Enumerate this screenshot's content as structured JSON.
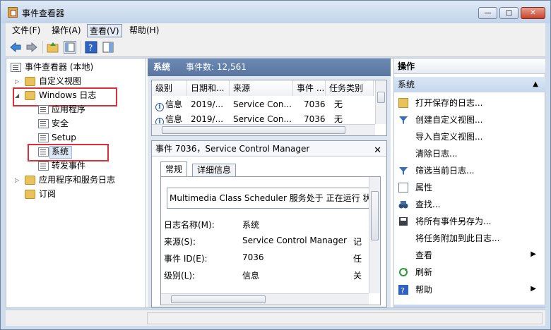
{
  "window": {
    "title": "事件查看器",
    "min": "—",
    "max": "□",
    "close": "✕"
  },
  "menu": [
    {
      "label": "文件(F)"
    },
    {
      "label": "操作(A)"
    },
    {
      "label": "查看(V)"
    },
    {
      "label": "帮助(H)"
    }
  ],
  "tree": {
    "root": "事件查看器 (本地)",
    "custom_views": "自定义视图",
    "windows_logs": "Windows 日志",
    "application": "应用程序",
    "security": "安全",
    "setup": "Setup",
    "system": "系统",
    "forwarded": "转发事件",
    "app_services": "应用程序和服务日志",
    "subscriptions": "订阅"
  },
  "log_header": {
    "name": "系统",
    "count_label": "事件数: 12,561"
  },
  "grid": {
    "columns": [
      "级别",
      "日期和...",
      "来源",
      "事件 ...",
      "任务类别"
    ],
    "rows": [
      {
        "level": "信息",
        "date": "2019/...",
        "source": "Service Con...",
        "event": "7036",
        "task": "无"
      },
      {
        "level": "信息",
        "date": "2019/...",
        "source": "Service Con...",
        "event": "7036",
        "task": "无"
      }
    ]
  },
  "detail": {
    "title": "事件 7036，Service Control Manager",
    "close": "✕",
    "tabs": [
      "常规",
      "详细信息"
    ],
    "description": "Multimedia Class Scheduler 服务处于 正在运行 状",
    "fields": [
      {
        "key": "日志名称(M):",
        "value": "系统",
        "extra": ""
      },
      {
        "key": "来源(S):",
        "value": "Service Control Manager",
        "extra": "记"
      },
      {
        "key": "事件 ID(E):",
        "value": "7036",
        "extra": "任"
      },
      {
        "key": "级别(L):",
        "value": "信息",
        "extra": "关"
      }
    ]
  },
  "actions": {
    "header": "操作",
    "section": "系统",
    "items": [
      {
        "label": "打开保存的日志...",
        "icon": "open-folder-icon"
      },
      {
        "label": "创建自定义视图...",
        "icon": "filter-icon"
      },
      {
        "label": "导入自定义视图...",
        "icon": ""
      },
      {
        "label": "清除日志...",
        "icon": ""
      },
      {
        "label": "筛选当前日志...",
        "icon": "filter-icon"
      },
      {
        "label": "属性",
        "icon": "properties-icon"
      },
      {
        "label": "查找...",
        "icon": "binoculars-icon"
      },
      {
        "label": "将所有事件另存为...",
        "icon": "save-icon"
      },
      {
        "label": "将任务附加到此日志...",
        "icon": ""
      },
      {
        "label": "查看",
        "icon": ""
      },
      {
        "label": "刷新",
        "icon": "refresh-icon"
      },
      {
        "label": "帮助",
        "icon": "help-icon"
      }
    ]
  },
  "colors": {
    "header": "#5a76a0",
    "accent": "#d9303a",
    "selection": "#dde8f7"
  }
}
